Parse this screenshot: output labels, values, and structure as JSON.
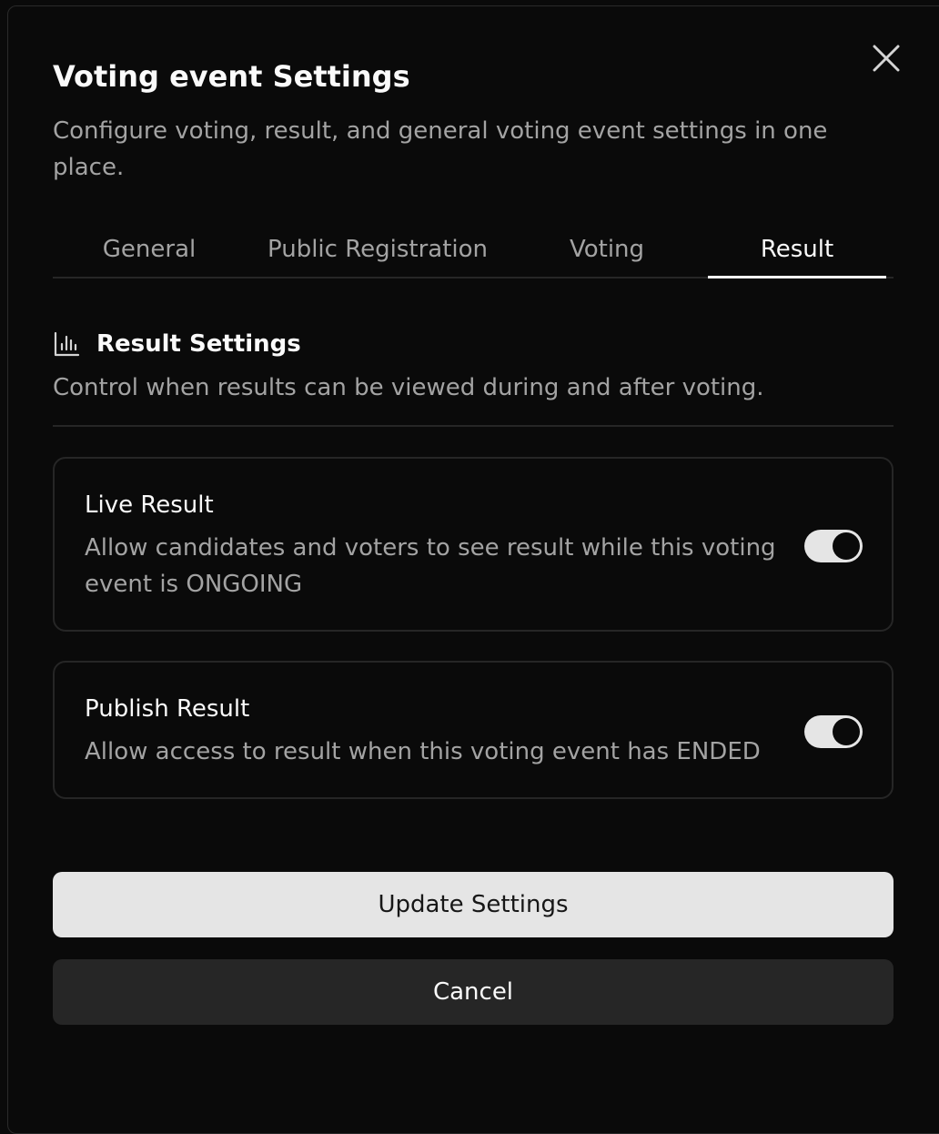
{
  "dialog": {
    "title": "Voting event Settings",
    "description": "Configure voting, result, and general voting event settings in one place."
  },
  "tabs": [
    {
      "label": "General",
      "active": false
    },
    {
      "label": "Public Registration",
      "active": false
    },
    {
      "label": "Voting",
      "active": false
    },
    {
      "label": "Result",
      "active": true
    }
  ],
  "section": {
    "icon": "bar-chart-icon",
    "title": "Result Settings",
    "description": "Control when results can be viewed during and after voting."
  },
  "settings": [
    {
      "title": "Live Result",
      "description": "Allow candidates and voters to see result while this voting event is ONGOING",
      "enabled": true
    },
    {
      "title": "Publish Result",
      "description": "Allow access to result when this voting event has ENDED",
      "enabled": true
    }
  ],
  "actions": {
    "update_label": "Update Settings",
    "cancel_label": "Cancel"
  },
  "colors": {
    "background": "#0a0a0a",
    "border": "#262626",
    "muted_text": "#a3a3a3",
    "primary_button": "#e5e5e5",
    "secondary_button": "#262626"
  }
}
